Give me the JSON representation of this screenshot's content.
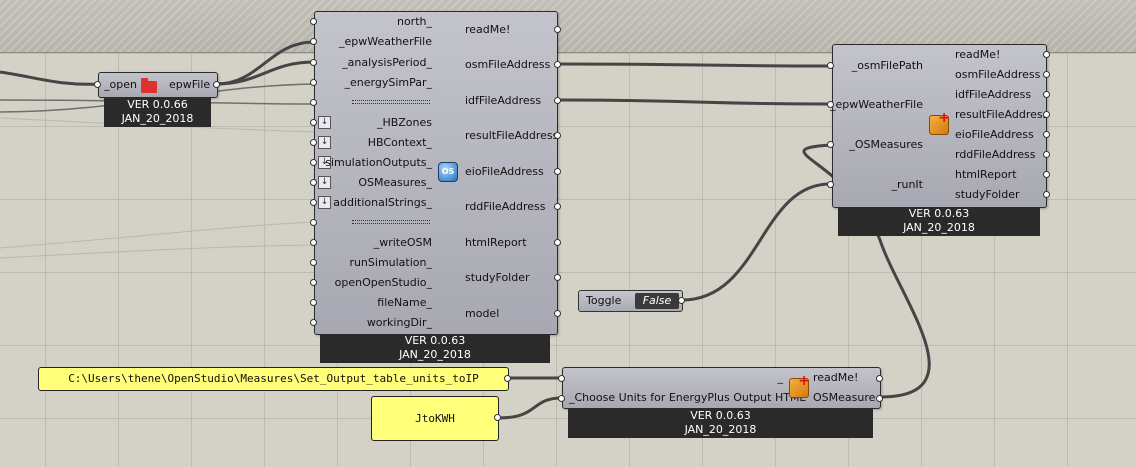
{
  "open_epw": {
    "input": "_open",
    "output": "epwFile",
    "version": "VER 0.0.66",
    "date": "JAN_20_2018"
  },
  "export_to_openstudio": {
    "inputs": {
      "north": "north_",
      "epw": "_epwWeatherFile",
      "analysis": "_analysisPeriod_",
      "energy_sim": "_energySimPar_",
      "hbzones": "_HBZones",
      "hbcontext": "HBContext_",
      "sim_outputs": "simulationOutputs_",
      "osmeasures": "OSMeasures_",
      "additional": "additionalStrings_",
      "write_osm": "_writeOSM",
      "run_sim": "runSimulation_",
      "open_os": "openOpenStudio_",
      "filename": "fileName_",
      "workdir": "workingDir_"
    },
    "outputs": {
      "readme": "readMe!",
      "osm": "osmFileAddress",
      "idf": "idfFileAddress",
      "result": "resultFileAddress",
      "eio": "eioFileAddress",
      "rdd": "rddFileAddress",
      "html": "htmlReport",
      "study": "studyFolder",
      "model": "model"
    },
    "icon": "openstudio-icon",
    "version": "VER 0.0.63",
    "date": "JAN_20_2018"
  },
  "run_osm": {
    "inputs": {
      "osm_path": "_osmFilePath",
      "epw": "_epwWeatherFile",
      "measures": "_OSMeasures",
      "run": "_runIt"
    },
    "outputs": {
      "readme": "readMe!",
      "osm": "osmFileAddress",
      "idf": "idfFileAddress",
      "result": "resultFileAddress",
      "eio": "eioFileAddress",
      "rdd": "rddFileAddress",
      "html": "htmlReport",
      "study": "studyFolder"
    },
    "icon": "honeybee-icon",
    "version": "VER 0.0.63",
    "date": "JAN_20_2018"
  },
  "toggle": {
    "label": "Toggle",
    "value": "False"
  },
  "measure_component": {
    "inputs": {
      "top": "_",
      "units": "_Choose Units for EnergyPlus Output HTML"
    },
    "outputs": {
      "readme": "readMe!",
      "measure": "OSMeasure"
    },
    "icon": "honeybee-icon",
    "version": "VER 0.0.63",
    "date": "JAN_20_2018"
  },
  "panels": {
    "path": "C:\\Users\\thene\\OpenStudio\\Measures\\Set_Output_table_units_toIP",
    "units": "JtoKWH"
  }
}
